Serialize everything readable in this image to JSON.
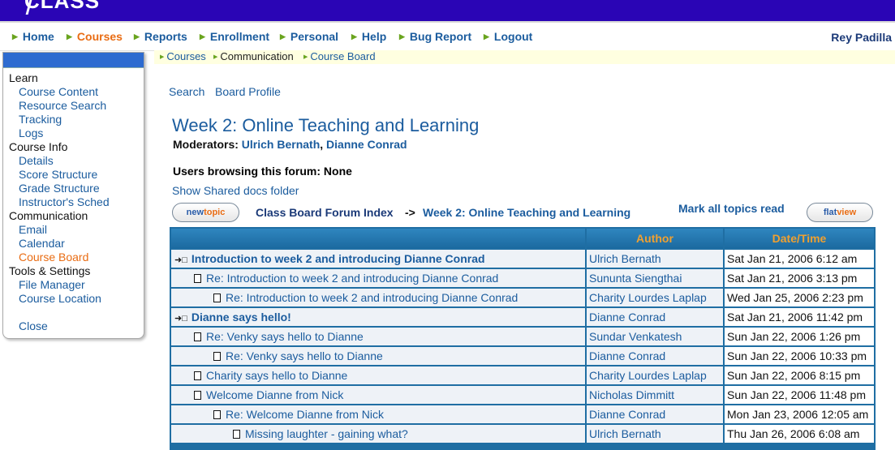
{
  "app": {
    "logo_text": "CLASS",
    "user_name": "Rey Padilla"
  },
  "nav": [
    {
      "label": "Home",
      "active": false
    },
    {
      "label": "Courses",
      "active": true
    },
    {
      "label": "Reports",
      "active": false
    },
    {
      "label": "Enrollment",
      "active": false
    },
    {
      "label": "Personal",
      "active": false
    },
    {
      "label": "Help",
      "active": false
    },
    {
      "label": "Bug Report",
      "active": false
    },
    {
      "label": "Logout",
      "active": false
    }
  ],
  "breadcrumb": [
    "Courses",
    "Communication",
    "Course Board"
  ],
  "sidebar": {
    "sections": [
      {
        "title": "Learn",
        "items": [
          "Course Content",
          "Resource Search",
          "Tracking",
          "Logs"
        ]
      },
      {
        "title": "Course Info",
        "items": [
          "Details",
          "Score Structure",
          "Grade Structure",
          "Instructor's Sched"
        ]
      },
      {
        "title": "Communication",
        "items": [
          "Email",
          "Calendar",
          "Course Board"
        ]
      },
      {
        "title": "Tools & Settings",
        "items": [
          "File Manager",
          "Course Location"
        ]
      }
    ],
    "active_item": "Course Board",
    "close_label": "Close"
  },
  "top_links": {
    "search": "Search",
    "profile": "Board Profile"
  },
  "forum": {
    "title": "Week 2: Online Teaching and Learning",
    "moderators_label": "Moderators:",
    "moderators": [
      "Ulrich Bernath",
      "Dianne Conrad"
    ],
    "browsing": "Users browsing this forum: None",
    "shared_docs": "Show Shared docs folder",
    "nav_index": "Class Board Forum Index",
    "nav_arrow": "->",
    "nav_forum": "Week 2: Online Teaching and Learning",
    "mark_read": "Mark all topics read",
    "new_topic": {
      "part1": "new",
      "part2": "topic"
    },
    "flat_view": {
      "part1": "flat",
      "part2": "view"
    }
  },
  "table": {
    "headers": [
      "",
      "Author",
      "Date/Time"
    ],
    "rows": [
      {
        "title": "Introduction to week 2 and introducing Dianne Conrad",
        "author": "Ulrich Bernath",
        "date": "Sat Jan 21, 2006 6:12 am",
        "level": 0,
        "root": true
      },
      {
        "title": "Re: Introduction to week 2 and introducing Dianne Conrad",
        "author": "Sununta Siengthai",
        "date": "Sat Jan 21, 2006 3:13 pm",
        "level": 1,
        "root": false
      },
      {
        "title": "Re: Introduction to week 2 and introducing Dianne Conrad",
        "author": "Charity Lourdes Laplap",
        "date": "Wed Jan 25, 2006 2:23 pm",
        "level": 2,
        "root": false
      },
      {
        "title": "Dianne says hello!",
        "author": "Dianne Conrad",
        "date": "Sat Jan 21, 2006 11:42 pm",
        "level": 0,
        "root": true
      },
      {
        "title": "Re: Venky says hello to Dianne",
        "author": "Sundar Venkatesh",
        "date": "Sun Jan 22, 2006 1:26 pm",
        "level": 1,
        "root": false
      },
      {
        "title": "Re: Venky says hello to Dianne",
        "author": "Dianne Conrad",
        "date": "Sun Jan 22, 2006 10:33 pm",
        "level": 2,
        "root": false
      },
      {
        "title": "Charity says hello to Dianne",
        "author": "Charity Lourdes Laplap",
        "date": "Sun Jan 22, 2006 8:15 pm",
        "level": 1,
        "root": false
      },
      {
        "title": "Welcome Dianne from Nick",
        "author": "Nicholas Dimmitt",
        "date": "Sun Jan 22, 2006 11:48 pm",
        "level": 1,
        "root": false
      },
      {
        "title": "Re: Welcome Dianne from Nick",
        "author": "Dianne Conrad",
        "date": "Mon Jan 23, 2006 12:05 am",
        "level": 2,
        "root": false
      },
      {
        "title": "Missing laughter - gaining what?",
        "author": "Ulrich Bernath",
        "date": "Thu Jan 26, 2006 6:08 am",
        "level": 3,
        "root": false
      }
    ]
  },
  "colors": {
    "banner": "#2a05b5",
    "link": "#1b5c9e",
    "active": "#e96c13",
    "nav_arrow": "#6aa41e",
    "table_frame": "#1f6ea3",
    "table_header_text": "#f0a030"
  }
}
